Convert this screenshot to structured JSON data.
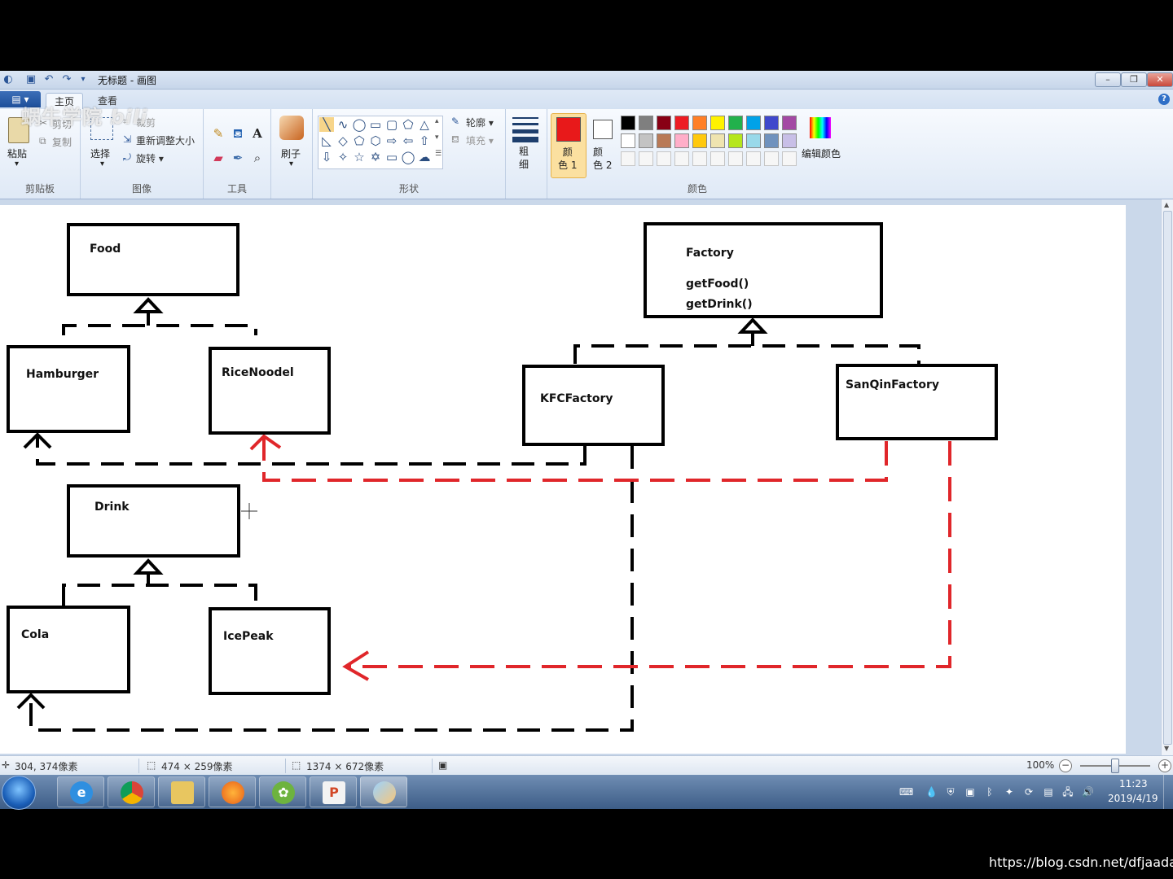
{
  "window": {
    "title": "无标题 - 画图",
    "minimize": "–",
    "restore": "❐",
    "close": "✕"
  },
  "tabs": {
    "menu": "▤ ▾",
    "home": "主页",
    "view": "查看"
  },
  "watermark": "蜗牛学院",
  "ribbon": {
    "clipboard": {
      "label": "剪贴板",
      "paste": "粘贴",
      "cut": "剪切",
      "copy": "复制"
    },
    "image": {
      "label": "图像",
      "select": "选择",
      "crop": "裁剪",
      "resize": "重新调整大小",
      "rotate": "旋转 ▾"
    },
    "tools": {
      "label": "工具"
    },
    "brushes": {
      "label": "刷子"
    },
    "shapes": {
      "label": "形状",
      "outline": "轮廓 ▾",
      "fill": "填充 ▾"
    },
    "size": {
      "label": "粗\n细"
    },
    "colors": {
      "label": "颜色",
      "color1": "颜\n色 1",
      "color2": "颜\n色 2",
      "edit": "编辑颜色",
      "color1_value": "#e8191a",
      "color2_value": "#ffffff",
      "palette_row1": [
        "#000000",
        "#7f7f7f",
        "#880015",
        "#ed1c24",
        "#ff7f27",
        "#fff200",
        "#22b14c",
        "#00a2e8",
        "#3f48cc",
        "#a349a4"
      ],
      "palette_row2": [
        "#ffffff",
        "#c3c3c3",
        "#b97a57",
        "#ffaec9",
        "#ffc90e",
        "#efe4b0",
        "#b5e61d",
        "#99d9ea",
        "#7092be",
        "#c8bfe7"
      ]
    }
  },
  "diagram": {
    "boxes": {
      "food": "Food",
      "hamburger": "Hamburger",
      "ricenoodel": "RiceNoodel",
      "drink": "Drink",
      "cola": "Cola",
      "icepeak": "IcePeak",
      "factory": "Factory",
      "factory_method1": "getFood()",
      "factory_method2": "getDrink()",
      "kfc": "KFCFactory",
      "sanqin": "SanQinFactory"
    },
    "line_colors": {
      "black": "#000000",
      "red": "#e0262a"
    }
  },
  "status": {
    "cursor_pos": "304, 374像素",
    "selection_size": "474 × 259像素",
    "image_size": "1374 × 672像素",
    "zoom": "100%"
  },
  "taskbar": {
    "clock_time": "11:23",
    "clock_date": "2019/4/19"
  },
  "footer_url": "https://blog.csdn.net/dfjaadada"
}
